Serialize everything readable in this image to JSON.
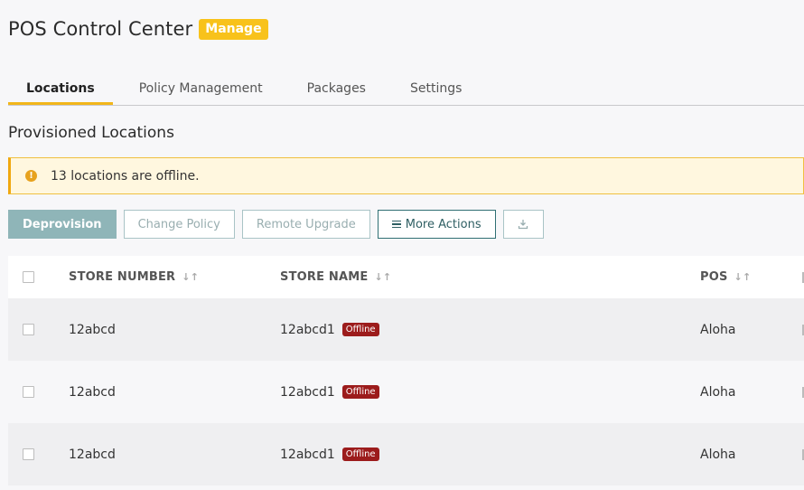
{
  "header": {
    "title": "POS Control Center",
    "badge": "Manage"
  },
  "tabs": [
    {
      "label": "Locations"
    },
    {
      "label": "Policy Management"
    },
    {
      "label": "Packages"
    },
    {
      "label": "Settings"
    }
  ],
  "section": {
    "title": "Provisioned Locations"
  },
  "alert": {
    "icon": "!",
    "text": "13 locations are offline."
  },
  "toolbar": {
    "deprovision": "Deprovision",
    "change_policy": "Change Policy",
    "remote_upgrade": "Remote Upgrade",
    "more_actions": "More Actions",
    "download_icon": "download-icon"
  },
  "table": {
    "columns": {
      "store_number": "STORE NUMBER",
      "store_name": "STORE NAME",
      "pos": "POS",
      "sort_glyph": "↓↑"
    },
    "rows": [
      {
        "store_number": "12abcd",
        "store_name": "12abcd1",
        "status": "Offline",
        "pos": "Aloha"
      },
      {
        "store_number": "12abcd",
        "store_name": "12abcd1",
        "status": "Offline",
        "pos": "Aloha"
      },
      {
        "store_number": "12abcd",
        "store_name": "12abcd1",
        "status": "Offline",
        "pos": "Aloha"
      }
    ]
  },
  "colors": {
    "accent": "#f8c21b",
    "teal": "#2f6f73",
    "offline": "#9c1c1c",
    "warning": "#e7a21e"
  }
}
